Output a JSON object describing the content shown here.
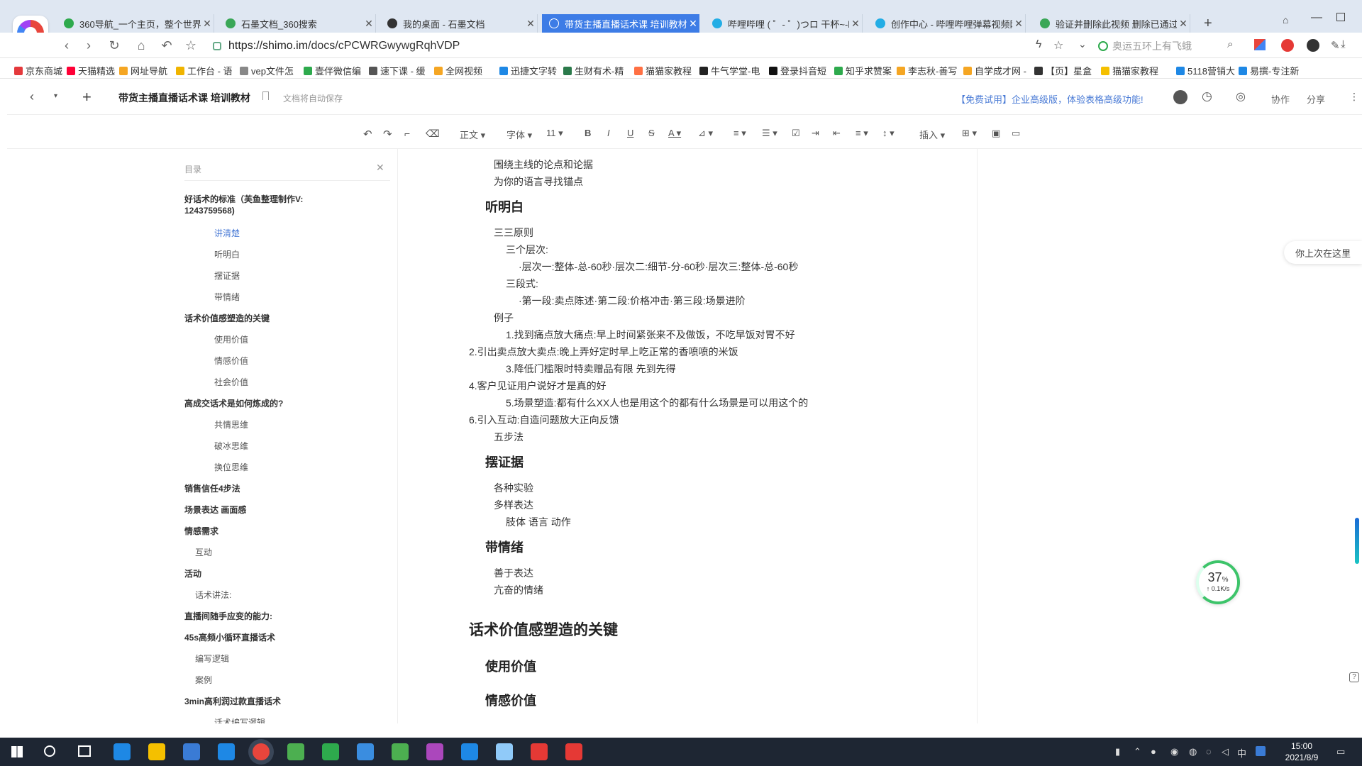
{
  "browser": {
    "tabs": [
      {
        "label": "360导航_一个主页，整个世界",
        "color": "#2eaa4d",
        "active": false
      },
      {
        "label": "石墨文档_360搜索",
        "color": "#3aa757",
        "active": false
      },
      {
        "label": "我的桌面 - 石墨文档",
        "color": "#333333",
        "active": false
      },
      {
        "label": "带货主播直播话术课 培训教材",
        "color": "#ffffff",
        "active": true
      },
      {
        "label": "哔哩哔哩 ( ゜- ゜)つロ 干杯~-bili",
        "color": "#23ade5",
        "active": false
      },
      {
        "label": "创作中心 - 哔哩哔哩弹幕视频网",
        "color": "#23ade5",
        "active": false
      },
      {
        "label": "验证并删除此视频 删除已通过",
        "color": "#3aa757",
        "active": false
      }
    ],
    "new_tab": "+",
    "url_host": "https://shimo.im",
    "url_path": "/docs/cPCWRGwywgRqhVDP",
    "search_placeholder": "奥运五环上有飞蛾",
    "bookmarks": [
      {
        "label": "京东商城",
        "color": "#e4393c"
      },
      {
        "label": "天猫精选",
        "color": "#ff0036"
      },
      {
        "label": "网址导航",
        "color": "#f5a623"
      },
      {
        "label": "工作台 - 语",
        "color": "#f0b400"
      },
      {
        "label": "vep文件怎",
        "color": "#888888"
      },
      {
        "label": "壹伴微信编",
        "color": "#2eaa4d"
      },
      {
        "label": "速下课 - 缓",
        "color": "#555555"
      },
      {
        "label": "全网视频",
        "color": "#f5a623"
      },
      {
        "label": "迅捷文字转",
        "color": "#1e88e5"
      },
      {
        "label": "生财有术-精",
        "color": "#2b7a4b"
      },
      {
        "label": "猫猫家教程",
        "color": "#ff7043"
      },
      {
        "label": "牛气学堂-电",
        "color": "#222222"
      },
      {
        "label": "登录抖音短",
        "color": "#111111"
      },
      {
        "label": "知乎求赞案",
        "color": "#2eaa4d"
      },
      {
        "label": "李志秋-善写",
        "color": "#f5a623"
      },
      {
        "label": "自学成才网 -",
        "color": "#f5a623"
      },
      {
        "label": "【页】星盒",
        "color": "#333333"
      },
      {
        "label": "猫猫家教程",
        "color": "#f5c000"
      },
      {
        "label": "5118营销大",
        "color": "#1e88e5"
      },
      {
        "label": "易撰-专注新",
        "color": "#1e88e5"
      }
    ]
  },
  "app": {
    "doc_title": "带货主播直播话术课 培训教材",
    "autosave": "文档将自动保存",
    "promo": "【免费试用】企业高级版，体验表格高级功能!",
    "collab": "协作",
    "share": "分享",
    "toolbar": {
      "style": "正文",
      "font": "字体",
      "size": "11",
      "insert": "插入"
    }
  },
  "outline": {
    "title": "目录",
    "items": [
      {
        "text": "好话术的标准（芙鱼整理制作V:",
        "level": 1
      },
      {
        "text": "1243759568)",
        "level": 1
      },
      {
        "text": "讲清楚",
        "level": 3,
        "active": true
      },
      {
        "text": "听明白",
        "level": 3
      },
      {
        "text": "摆证据",
        "level": 3
      },
      {
        "text": "带情绪",
        "level": 3
      },
      {
        "text": "话术价值感塑造的关键",
        "level": 1
      },
      {
        "text": "使用价值",
        "level": 3
      },
      {
        "text": "情感价值",
        "level": 3
      },
      {
        "text": "社会价值",
        "level": 3
      },
      {
        "text": "高成交话术是如何炼成的?",
        "level": 1
      },
      {
        "text": "共情思维",
        "level": 3
      },
      {
        "text": "破冰思维",
        "level": 3
      },
      {
        "text": "换位思维",
        "level": 3
      },
      {
        "text": "销售信任4步法",
        "level": 1
      },
      {
        "text": "场景表达 画面感",
        "level": 1
      },
      {
        "text": "情感需求",
        "level": 1
      },
      {
        "text": "互动",
        "level": 2
      },
      {
        "text": "活动",
        "level": 1
      },
      {
        "text": "话术讲法:",
        "level": 2
      },
      {
        "text": "直播间随手应变的能力:",
        "level": 1
      },
      {
        "text": "45s高频小循环直播话术",
        "level": 1
      },
      {
        "text": "编写逻辑",
        "level": 2
      },
      {
        "text": "案例",
        "level": 2
      },
      {
        "text": "3min高利润过款直播话术",
        "level": 1
      },
      {
        "text": "话术编写逻辑",
        "level": 3
      }
    ]
  },
  "doc": {
    "lines": [
      {
        "text": "围绕主线的论点和论据",
        "kind": "p",
        "indent": 2
      },
      {
        "text": "为你的语言寻找锚点",
        "kind": "p",
        "indent": 2
      },
      {
        "text": "听明白",
        "kind": "h2"
      },
      {
        "text": "三三原则",
        "kind": "p",
        "indent": 2
      },
      {
        "text": "三个层次:",
        "kind": "p",
        "indent": 3
      },
      {
        "text": "·层次一:整体-总-60秒·层次二:细节-分-60秒·层次三:整体-总-60秒",
        "kind": "p",
        "indent": 4
      },
      {
        "text": "三段式:",
        "kind": "p",
        "indent": 3
      },
      {
        "text": "·第一段:卖点陈述·第二段:价格冲击·第三段:场景进阶",
        "kind": "p",
        "indent": 4
      },
      {
        "text": "例子",
        "kind": "p",
        "indent": 2
      },
      {
        "text": "1.找到痛点放大痛点:早上时间紧张来不及做饭，不吃早饭对胃不好",
        "kind": "p",
        "indent": 3
      },
      {
        "text": "2.引出卖点放大卖点:晚上弄好定时早上吃正常的香喷喷的米饭",
        "kind": "p",
        "indent": 1
      },
      {
        "text": "3.降低门槛限时特卖赠品有限 先到先得",
        "kind": "p",
        "indent": 3
      },
      {
        "text": "4.客户见证用户说好才是真的好",
        "kind": "p",
        "indent": 1
      },
      {
        "text": "5.场景塑造:都有什么XX人也是用这个的都有什么场景是可以用这个的",
        "kind": "p",
        "indent": 3
      },
      {
        "text": "6.引入互动:自造问题放大正向反馈",
        "kind": "p",
        "indent": 1
      },
      {
        "text": "五步法",
        "kind": "p",
        "indent": 2
      },
      {
        "text": "摆证据",
        "kind": "h2"
      },
      {
        "text": "各种实验",
        "kind": "p",
        "indent": 2
      },
      {
        "text": "多样表达",
        "kind": "p",
        "indent": 2
      },
      {
        "text": "肢体  语言  动作",
        "kind": "p",
        "indent": 3
      },
      {
        "text": "带情绪",
        "kind": "h2"
      },
      {
        "text": "善于表达",
        "kind": "p",
        "indent": 2
      },
      {
        "text": "亢奋的情绪",
        "kind": "p",
        "indent": 2
      },
      {
        "text": "话术价值感塑造的关键",
        "kind": "h1"
      },
      {
        "text": "使用价值",
        "kind": "h2"
      },
      {
        "text": "情感价值",
        "kind": "h2"
      }
    ],
    "last_here": "你上次在这里"
  },
  "net_widget": {
    "percent": "37",
    "unit": "%",
    "speed": "↑ 0.1K/s"
  },
  "taskbar": {
    "time": "15:00",
    "date": "2021/8/9",
    "ime": "中",
    "icons": [
      {
        "name": "ie",
        "color": "#1e88e5"
      },
      {
        "name": "folder",
        "color": "#f5c000"
      },
      {
        "name": "store",
        "color": "#3a7bd5"
      },
      {
        "name": "mail",
        "color": "#1e88e5"
      },
      {
        "name": "360browser",
        "color": "#e8453c"
      },
      {
        "name": "green-app",
        "color": "#4caf50"
      },
      {
        "name": "wechat",
        "color": "#2eaa4d"
      },
      {
        "name": "ie2",
        "color": "#3a8de0"
      },
      {
        "name": "camtasia",
        "color": "#4caf50"
      },
      {
        "name": "colors",
        "color": "#ab47bc"
      },
      {
        "name": "editor",
        "color": "#1e88e5"
      },
      {
        "name": "cloud",
        "color": "#90caf9"
      },
      {
        "name": "pdf",
        "color": "#e53935"
      },
      {
        "name": "capcut",
        "color": "#e53935"
      }
    ]
  }
}
